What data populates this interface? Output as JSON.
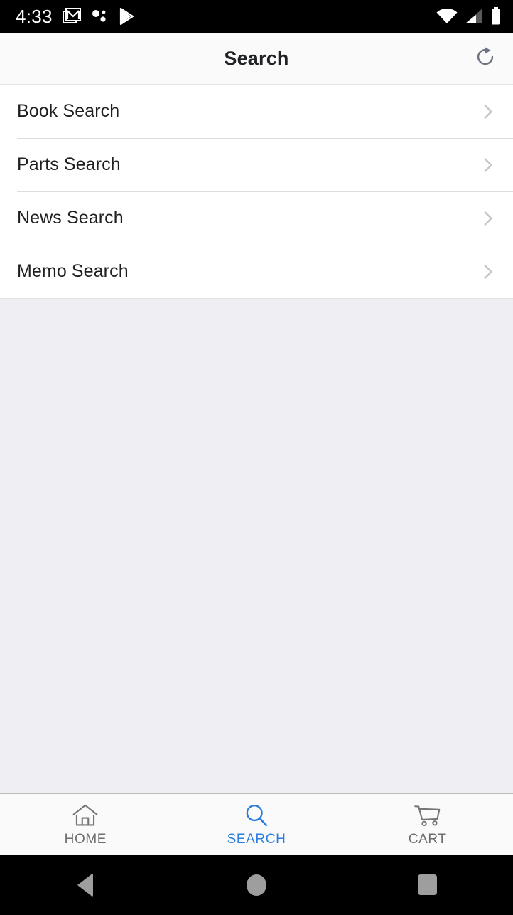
{
  "status_bar": {
    "time": "4:33",
    "left_icons": [
      "gmail-icon",
      "dots-bubble-icon",
      "play-store-icon"
    ],
    "right_icons": [
      "wifi-icon",
      "cellular-signal-icon",
      "battery-icon"
    ],
    "background": "#000000",
    "foreground": "#ffffff"
  },
  "header": {
    "title": "Search",
    "refresh_icon": "refresh-icon",
    "background": "#fafafa",
    "title_color": "#202124",
    "icon_color": "#6c7280"
  },
  "list": {
    "chevron_icon": "chevron-right-icon",
    "chevron_color": "#c4c4c6",
    "items": [
      {
        "label": "Book Search"
      },
      {
        "label": "Parts Search"
      },
      {
        "label": "News Search"
      },
      {
        "label": "Memo Search"
      }
    ]
  },
  "content": {
    "empty": true,
    "background": "#efeef3"
  },
  "tab_bar": {
    "active_color": "#2b7de0",
    "inactive_color": "#6e6e6e",
    "background": "#fafafa",
    "tabs": [
      {
        "label": "HOME",
        "icon": "home-icon",
        "active": false
      },
      {
        "label": "SEARCH",
        "icon": "search-icon",
        "active": true
      },
      {
        "label": "CART",
        "icon": "cart-icon",
        "active": false
      }
    ]
  },
  "nav_bar": {
    "background": "#000000",
    "button_color": "#9e9e9e",
    "buttons": [
      {
        "name": "back-button",
        "icon": "triangle-back-icon"
      },
      {
        "name": "home-button",
        "icon": "circle-home-icon"
      },
      {
        "name": "recents-button",
        "icon": "square-recents-icon"
      }
    ]
  }
}
